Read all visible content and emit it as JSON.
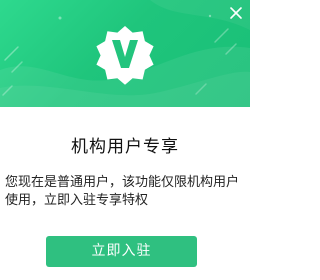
{
  "dialog": {
    "title": "机构用户专享",
    "description": "您现在是普通用户，该功能仅限机构用户使用，立即入驻专享特权",
    "cta_label": "立即入驻"
  },
  "icons": {
    "close": "close-icon",
    "badge": "verified-v-badge-icon"
  },
  "colors": {
    "banner_start": "#2ed98e",
    "banner_end": "#19bf77",
    "button": "#2fc080",
    "badge_fill": "#ffffff",
    "badge_letter": "#22c47d"
  }
}
